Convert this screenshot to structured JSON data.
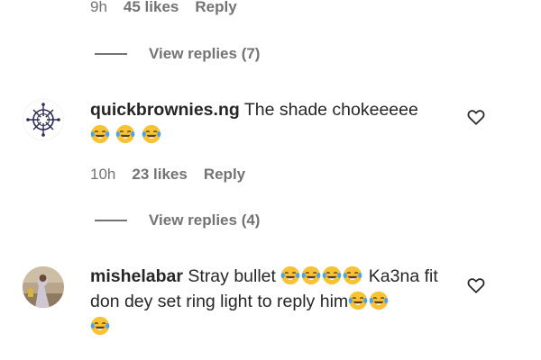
{
  "top_comment_meta": {
    "time": "9h",
    "likes": "45 likes",
    "reply": "Reply"
  },
  "top_replies": {
    "label": "View replies (7)"
  },
  "comments": [
    {
      "username": "quickbrownies.ng",
      "text": "The shade chokeeeee",
      "emoji_after_text": [
        "face-with-tears-of-joy",
        "face-with-tears-of-joy",
        "face-with-tears-of-joy"
      ],
      "time": "10h",
      "likes": "23 likes",
      "reply": "Reply",
      "view_replies": "View replies (4)"
    },
    {
      "username": "mishelabar",
      "text_part1": "Stray bullet",
      "text_part2": "Ka3na fit don dey set ring light to reply him",
      "emoji_count_after_part1": 4,
      "emoji_count_after_part2": 3
    }
  ],
  "colors": {
    "text": "#262626",
    "secondary": "#737373",
    "background": "#ffffff"
  },
  "icons": {
    "like": "heart-outline-icon",
    "emoji": "face-with-tears-of-joy"
  }
}
